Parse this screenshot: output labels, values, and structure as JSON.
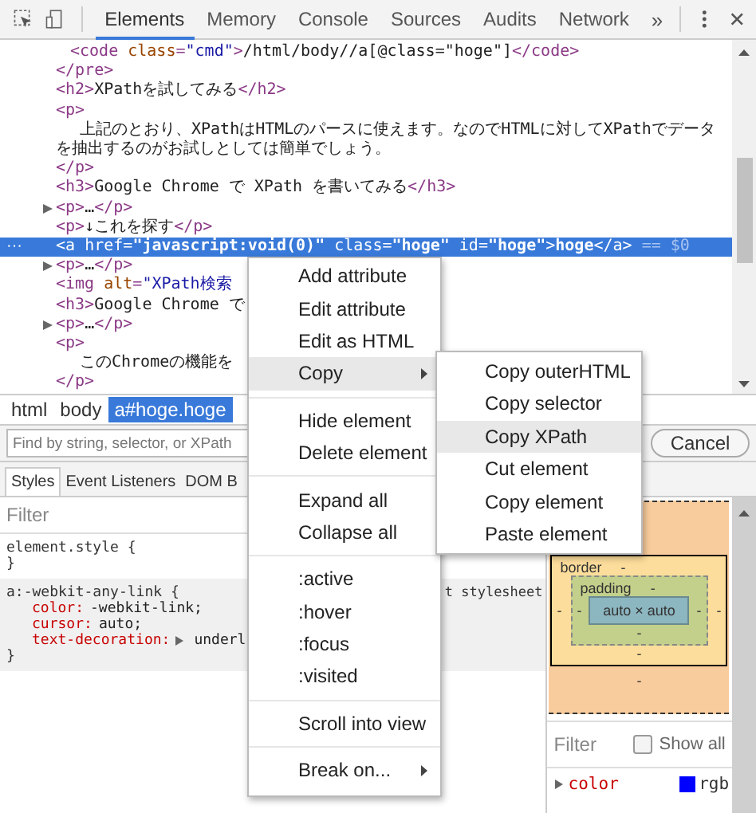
{
  "toolbar": {
    "tabs": [
      {
        "label": "Elements",
        "selected": true
      },
      {
        "label": "Memory",
        "selected": false
      },
      {
        "label": "Console",
        "selected": false
      },
      {
        "label": "Sources",
        "selected": false
      },
      {
        "label": "Audits",
        "selected": false
      },
      {
        "label": "Network",
        "selected": false
      }
    ],
    "overflow": "»"
  },
  "dom_tree": {
    "lines": [
      {
        "kind": "child",
        "expandable": false,
        "selected": false,
        "parts": [
          {
            "kind": "tag",
            "t": "<code "
          },
          {
            "kind": "attr",
            "t": "class"
          },
          {
            "kind": "tag",
            "t": "="
          },
          {
            "kind": "value",
            "t": "\"cmd\""
          },
          {
            "kind": "tag",
            "t": ">"
          },
          {
            "kind": "text",
            "t": "/html/body//a[@class=\"hoge\"]"
          },
          {
            "kind": "tag",
            "t": "</code>"
          }
        ]
      },
      {
        "kind": "tag",
        "expandable": false,
        "selected": false,
        "parts": [
          {
            "kind": "tag",
            "t": "</pre>"
          }
        ]
      },
      {
        "kind": "tag",
        "expandable": false,
        "selected": false,
        "parts": [
          {
            "kind": "tag",
            "t": "<h2>"
          },
          {
            "kind": "text",
            "t": "XPathを試してみる"
          },
          {
            "kind": "tag",
            "t": "</h2>"
          }
        ]
      },
      {
        "kind": "tag",
        "expandable": false,
        "selected": false,
        "parts": [
          {
            "kind": "tag",
            "t": "<p>"
          }
        ]
      },
      {
        "kind": "text",
        "expandable": false,
        "selected": false,
        "parts": [
          {
            "kind": "text",
            "t": "上記のとおり、XPathはHTMLのパースに使えます。なのでHTMLに対してXPathでデータ"
          }
        ]
      },
      {
        "kind": "wrap",
        "expandable": false,
        "selected": false,
        "parts": [
          {
            "kind": "text",
            "t": "を抽出するのがお試しとしては簡単でしょう。"
          }
        ]
      },
      {
        "kind": "tag",
        "expandable": false,
        "selected": false,
        "parts": [
          {
            "kind": "tag",
            "t": "</p>"
          }
        ]
      },
      {
        "kind": "tag",
        "expandable": false,
        "selected": false,
        "parts": [
          {
            "kind": "tag",
            "t": "<h3>"
          },
          {
            "kind": "text",
            "t": "Google Chrome で XPath を書いてみる"
          },
          {
            "kind": "tag",
            "t": "</h3>"
          }
        ]
      },
      {
        "kind": "tag",
        "expandable": true,
        "selected": false,
        "parts": [
          {
            "kind": "tag",
            "t": "<p>"
          },
          {
            "kind": "text",
            "t": "…"
          },
          {
            "kind": "tag",
            "t": "</p>"
          }
        ]
      },
      {
        "kind": "tag",
        "expandable": false,
        "selected": false,
        "parts": [
          {
            "kind": "tag",
            "t": "<p>"
          },
          {
            "kind": "text",
            "t": "↓これを探す"
          },
          {
            "kind": "tag",
            "t": "</p>"
          }
        ]
      },
      {
        "kind": "tag",
        "expandable": false,
        "selected": true,
        "gutter": "···",
        "parts": [
          {
            "kind": "tag",
            "t": "<a "
          },
          {
            "kind": "attr",
            "t": "href"
          },
          {
            "kind": "tag",
            "t": "="
          },
          {
            "kind": "value",
            "t": "\"javascript:void(0)\""
          },
          {
            "kind": "attr",
            "t": " class"
          },
          {
            "kind": "tag",
            "t": "="
          },
          {
            "kind": "value",
            "t": "\"hoge\""
          },
          {
            "kind": "attr",
            "t": " id"
          },
          {
            "kind": "tag",
            "t": "="
          },
          {
            "kind": "value",
            "t": "\"hoge\""
          },
          {
            "kind": "tag",
            "t": ">"
          },
          {
            "kind": "text",
            "t": "hoge"
          },
          {
            "kind": "tag",
            "t": "</a>"
          },
          {
            "kind": "marker",
            "t": " == $0"
          }
        ]
      },
      {
        "kind": "tag",
        "expandable": true,
        "selected": false,
        "parts": [
          {
            "kind": "tag",
            "t": "<p>"
          },
          {
            "kind": "text",
            "t": "…"
          },
          {
            "kind": "tag",
            "t": "</p>"
          }
        ]
      },
      {
        "kind": "tag",
        "expandable": false,
        "selected": false,
        "parts": [
          {
            "kind": "tag",
            "t": "<img "
          },
          {
            "kind": "attr",
            "t": "alt"
          },
          {
            "kind": "tag",
            "t": "="
          },
          {
            "kind": "value",
            "t": "\"XPath検索"
          }
        ]
      },
      {
        "kind": "tag",
        "expandable": false,
        "selected": false,
        "parts": [
          {
            "kind": "tag",
            "t": "<h3>"
          },
          {
            "kind": "text",
            "t": "Google Chrome で"
          }
        ]
      },
      {
        "kind": "tag",
        "expandable": true,
        "selected": false,
        "parts": [
          {
            "kind": "tag",
            "t": "<p>"
          },
          {
            "kind": "text",
            "t": "…"
          },
          {
            "kind": "tag",
            "t": "</p>"
          }
        ]
      },
      {
        "kind": "tag",
        "expandable": false,
        "selected": false,
        "parts": [
          {
            "kind": "tag",
            "t": "<p>"
          }
        ]
      },
      {
        "kind": "text",
        "expandable": false,
        "selected": false,
        "parts": [
          {
            "kind": "text",
            "t": "このChromeの機能を"
          }
        ]
      },
      {
        "kind": "tag",
        "expandable": false,
        "selected": false,
        "parts": [
          {
            "kind": "tag",
            "t": "</p>"
          }
        ]
      }
    ]
  },
  "breadcrumbs": [
    {
      "label": "html",
      "selected": false
    },
    {
      "label": "body",
      "selected": false
    },
    {
      "label": "a#hoge.hoge",
      "selected": true
    }
  ],
  "search": {
    "placeholder": "Find by string, selector, or XPath",
    "cancel": "Cancel"
  },
  "styles_tabs": [
    {
      "label": "Styles",
      "selected": true
    },
    {
      "label": "Event Listeners",
      "selected": false
    },
    {
      "label": "DOM B",
      "selected": false
    }
  ],
  "styles": {
    "filter_placeholder": "Filter",
    "rules": [
      {
        "selector": "element.style {",
        "shaded": false,
        "close": "}"
      },
      {
        "selector": "a:-webkit-any-link {",
        "source": "t stylesheet",
        "shaded": true,
        "declarations": [
          {
            "name": "color:",
            "value": "-webkit-link;",
            "expandable": false
          },
          {
            "name": "cursor:",
            "value": "auto;",
            "expandable": false
          },
          {
            "name": "text-decoration:",
            "value": "underl",
            "expandable": true
          }
        ],
        "close": "}"
      }
    ]
  },
  "box_model": {
    "border_label": "border",
    "border_top": "-",
    "padding_label": "padding",
    "padding_top": "-",
    "border_left": "-",
    "padding_left": "-",
    "content": "auto × auto",
    "padding_right": "-",
    "border_right": "-",
    "padding_bottom": "-",
    "border_bottom": "-",
    "margin_bottom": "-"
  },
  "computed": {
    "filter_placeholder": "Filter",
    "show_all": {
      "label": "Show all",
      "checked": false
    },
    "properties": [
      {
        "name": "color",
        "value": "rgb",
        "color": "#0000ff"
      }
    ]
  },
  "context_menu": {
    "groups": [
      [
        {
          "label": "Add attribute",
          "selected": false,
          "submenu": false
        },
        {
          "label": "Edit attribute",
          "selected": false,
          "submenu": false
        },
        {
          "label": "Edit as HTML",
          "selected": false,
          "submenu": false
        },
        {
          "label": "Copy",
          "selected": true,
          "submenu": true
        }
      ],
      [
        {
          "label": "Hide element",
          "selected": false,
          "submenu": false
        },
        {
          "label": "Delete element",
          "selected": false,
          "submenu": false
        }
      ],
      [
        {
          "label": "Expand all",
          "selected": false,
          "submenu": false
        },
        {
          "label": "Collapse all",
          "selected": false,
          "submenu": false
        }
      ],
      [
        {
          "label": ":active",
          "selected": false,
          "submenu": false
        },
        {
          "label": ":hover",
          "selected": false,
          "submenu": false
        },
        {
          "label": ":focus",
          "selected": false,
          "submenu": false
        },
        {
          "label": ":visited",
          "selected": false,
          "submenu": false
        }
      ],
      [
        {
          "label": "Scroll into view",
          "selected": false,
          "submenu": false
        }
      ],
      [
        {
          "label": "Break on...",
          "selected": false,
          "submenu": true
        }
      ]
    ]
  },
  "copy_submenu": {
    "items": [
      {
        "label": "Copy outerHTML",
        "selected": false
      },
      {
        "label": "Copy selector",
        "selected": false
      },
      {
        "label": "Copy XPath",
        "selected": true
      },
      {
        "label": "Cut element",
        "selected": false
      },
      {
        "label": "Copy element",
        "selected": false
      },
      {
        "label": "Paste element",
        "selected": false
      }
    ]
  }
}
